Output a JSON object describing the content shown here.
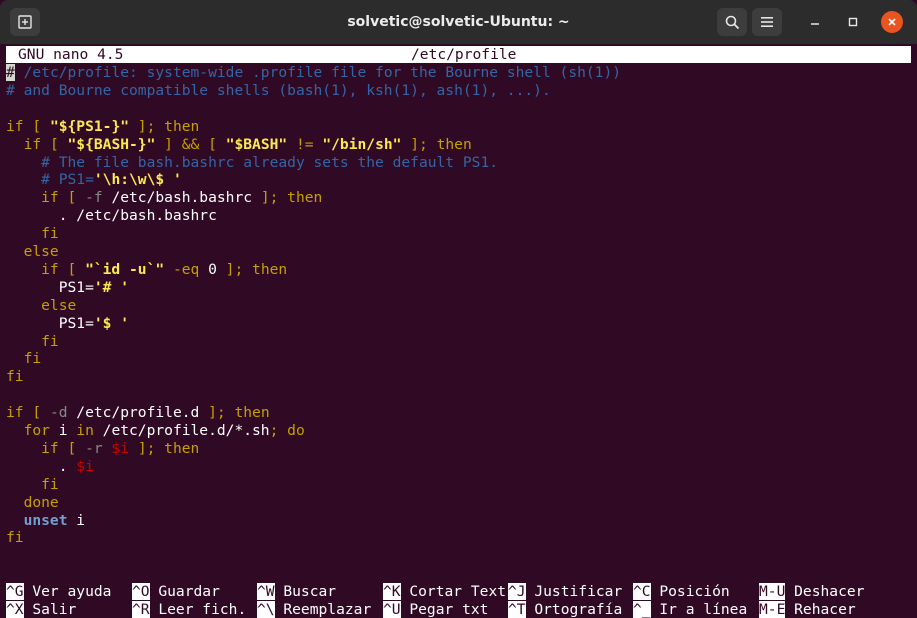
{
  "window": {
    "title": "solvetic@solvetic-Ubuntu: ~",
    "colors": {
      "titlebar": "#2c2c2c",
      "terminal_bg": "#300a24",
      "close": "#e95420"
    }
  },
  "nano": {
    "version": "GNU nano 4.5",
    "filename": "/etc/profile",
    "cursor_char": "#"
  },
  "file_lines": [
    [
      {
        "t": " /etc/profile: system-wide .profile file for the Bourne shell (sh(1))",
        "c": "c"
      }
    ],
    [
      {
        "t": "# and Bourne compatible shells (bash(1), ksh(1), ash(1), ...).",
        "c": "c"
      }
    ],
    [],
    [
      {
        "t": "if",
        "c": "k"
      },
      {
        "t": " [ ",
        "c": "k"
      },
      {
        "t": "\"${PS1-}\"",
        "c": "s"
      },
      {
        "t": " ]; then",
        "c": "k"
      }
    ],
    [
      {
        "t": "  if",
        "c": "k"
      },
      {
        "t": " [ ",
        "c": "k"
      },
      {
        "t": "\"${BASH-}\"",
        "c": "s"
      },
      {
        "t": " ] && [ ",
        "c": "k"
      },
      {
        "t": "\"$BASH\"",
        "c": "s"
      },
      {
        "t": " != ",
        "c": "k"
      },
      {
        "t": "\"/bin/sh\"",
        "c": "s"
      },
      {
        "t": " ]; then",
        "c": "k"
      }
    ],
    [
      {
        "t": "    # The file bash.bashrc already sets the default PS1.",
        "c": "c"
      }
    ],
    [
      {
        "t": "    # PS1=",
        "c": "c"
      },
      {
        "t": "'\\h:\\w\\$ '",
        "c": "s"
      }
    ],
    [
      {
        "t": "    if",
        "c": "k"
      },
      {
        "t": " [ ",
        "c": "k"
      },
      {
        "t": "-f",
        "c": "gr"
      },
      {
        "t": " /etc/bash.bashrc",
        "c": "w"
      },
      {
        "t": " ]; then",
        "c": "k"
      }
    ],
    [
      {
        "t": "      . /etc/bash.bashrc",
        "c": "w"
      }
    ],
    [
      {
        "t": "    fi",
        "c": "k"
      }
    ],
    [
      {
        "t": "  else",
        "c": "k"
      }
    ],
    [
      {
        "t": "    if",
        "c": "k"
      },
      {
        "t": " [ ",
        "c": "k"
      },
      {
        "t": "\"`id -u`\"",
        "c": "s"
      },
      {
        "t": " -eq ",
        "c": "k"
      },
      {
        "t": "0",
        "c": "w"
      },
      {
        "t": " ]; then",
        "c": "k"
      }
    ],
    [
      {
        "t": "      PS1=",
        "c": "w"
      },
      {
        "t": "'# '",
        "c": "s"
      }
    ],
    [
      {
        "t": "    else",
        "c": "k"
      }
    ],
    [
      {
        "t": "      PS1=",
        "c": "w"
      },
      {
        "t": "'$ '",
        "c": "s"
      }
    ],
    [
      {
        "t": "    fi",
        "c": "k"
      }
    ],
    [
      {
        "t": "  fi",
        "c": "k"
      }
    ],
    [
      {
        "t": "fi",
        "c": "k"
      }
    ],
    [],
    [
      {
        "t": "if",
        "c": "k"
      },
      {
        "t": " [ ",
        "c": "k"
      },
      {
        "t": "-d",
        "c": "gr"
      },
      {
        "t": " /etc/profile.d",
        "c": "w"
      },
      {
        "t": " ]; then",
        "c": "k"
      }
    ],
    [
      {
        "t": "  for",
        "c": "k"
      },
      {
        "t": " i ",
        "c": "w"
      },
      {
        "t": "in",
        "c": "k"
      },
      {
        "t": " /etc/profile.d/*.sh",
        "c": "w"
      },
      {
        "t": "; do",
        "c": "k"
      }
    ],
    [
      {
        "t": "    if",
        "c": "k"
      },
      {
        "t": " [ ",
        "c": "k"
      },
      {
        "t": "-r",
        "c": "gr"
      },
      {
        "t": " ",
        "c": "w"
      },
      {
        "t": "$i",
        "c": "v"
      },
      {
        "t": " ]; then",
        "c": "k"
      }
    ],
    [
      {
        "t": "      . ",
        "c": "w"
      },
      {
        "t": "$i",
        "c": "v"
      }
    ],
    [
      {
        "t": "    fi",
        "c": "k"
      }
    ],
    [
      {
        "t": "  done",
        "c": "k"
      }
    ],
    [
      {
        "t": "  unset",
        "c": "bl"
      },
      {
        "t": " i",
        "c": "w"
      }
    ],
    [
      {
        "t": "fi",
        "c": "k"
      }
    ]
  ],
  "shortcuts": [
    [
      {
        "key": "^G",
        "label": " Ver ayuda"
      },
      {
        "key": "^O",
        "label": " Guardar"
      },
      {
        "key": "^W",
        "label": " Buscar"
      },
      {
        "key": "^K",
        "label": " Cortar Text"
      },
      {
        "key": "^J",
        "label": " Justificar"
      },
      {
        "key": "^C",
        "label": " Posición"
      },
      {
        "key": "M-U",
        "label": " Deshacer"
      }
    ],
    [
      {
        "key": "^X",
        "label": " Salir"
      },
      {
        "key": "^R",
        "label": " Leer fich."
      },
      {
        "key": "^\\",
        "label": " Reemplazar"
      },
      {
        "key": "^U",
        "label": " Pegar txt"
      },
      {
        "key": "^T",
        "label": " Ortografía"
      },
      {
        "key": "^_",
        "label": " Ir a línea"
      },
      {
        "key": "M-E",
        "label": " Rehacer"
      }
    ]
  ],
  "icons": {
    "new_tab": "new-tab-icon",
    "search": "search-icon",
    "menu": "hamburger-menu-icon",
    "minimize": "minimize-icon",
    "maximize": "maximize-icon",
    "close": "close-icon"
  }
}
